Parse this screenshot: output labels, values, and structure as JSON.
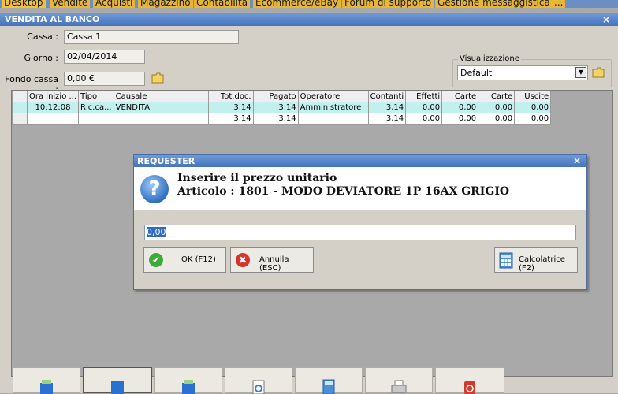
{
  "tabs": [
    "Desktop",
    "Vendite",
    "Acquisti",
    "Magazzino",
    "Contabilità",
    "Ecommerce/eBay",
    "Forum di supporto",
    "Gestione messaggistica",
    "..."
  ],
  "window": {
    "title": "VENDITA AL BANCO",
    "close": "×",
    "cassa_label": "Cassa :",
    "cassa_value": "Cassa 1",
    "giorno_label": "Giorno :",
    "giorno_value": "02/04/2014",
    "fondo_label": "Fondo cassa :",
    "fondo_value": "0,00 €",
    "view_label": "Visualizzazione",
    "view_value": "Default"
  },
  "grid": {
    "columns": [
      "Ora inizio ...",
      "Tipo",
      "Causale",
      "Tot.doc.",
      "Pagato",
      "Operatore",
      "Contanti",
      "Effetti",
      "Carte",
      "Carte",
      "Uscite"
    ],
    "rows": [
      [
        "10:12:08",
        "Ric.ca...",
        "VENDITA",
        "3,14",
        "3,14",
        "Amministratore",
        "3,14",
        "0,00",
        "0,00",
        "0,00",
        "0,00"
      ],
      [
        "",
        "",
        "",
        "3,14",
        "3,14",
        "",
        "3,14",
        "0,00",
        "0,00",
        "0,00",
        "0,00"
      ]
    ]
  },
  "dialog": {
    "title": "REQUESTER",
    "close": "×",
    "line1": "Inserire il prezzo unitario",
    "line2": "Articolo : 1801 - MODO DEVIATORE 1P 16AX GRIGIO",
    "input_value": "0,00",
    "ok_label": "OK (F12)",
    "cancel_label": "Annulla (ESC)",
    "calc_label": "Calcolatrice (F2)"
  },
  "icons": {
    "question": "?",
    "ok": "✔",
    "cancel": "✖"
  },
  "colors": {
    "title_bar": "#4574bd",
    "tab_active": "#f3c13a",
    "selected_row": "#c2f0ee"
  }
}
